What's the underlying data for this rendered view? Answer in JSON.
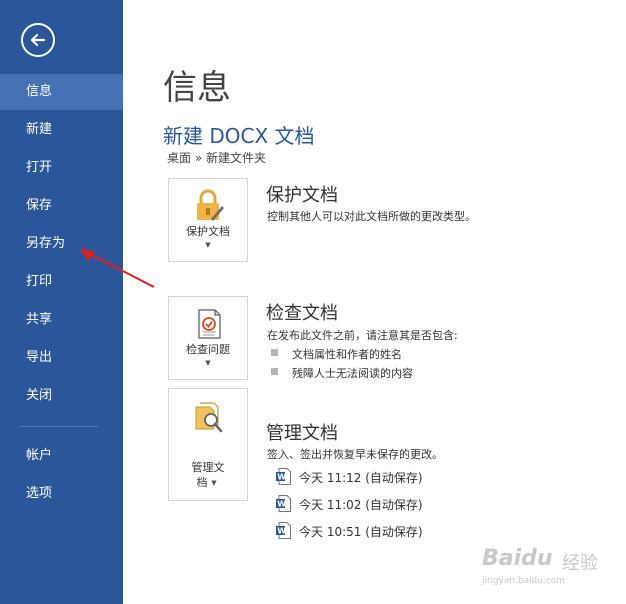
{
  "sidebar": {
    "back_label": "返回",
    "items": [
      {
        "label": "信息"
      },
      {
        "label": "新建"
      },
      {
        "label": "打开"
      },
      {
        "label": "保存"
      },
      {
        "label": "另存为"
      },
      {
        "label": "打印"
      },
      {
        "label": "共享"
      },
      {
        "label": "导出"
      },
      {
        "label": "关闭"
      },
      {
        "label": "帐户"
      },
      {
        "label": "选项"
      }
    ],
    "active_index": 0
  },
  "main": {
    "page_title": "信息",
    "doc_title": "新建 DOCX 文档",
    "path": "桌面 » 新建文件夹",
    "sections": [
      {
        "button_label": "保护文档",
        "title": "保护文档",
        "description": "控制其他人可以对此文档所做的更改类型。",
        "icon": "lock-icon"
      },
      {
        "button_label": "检查问题",
        "title": "检查文档",
        "description": "在发布此文件之前，请注意其是否包含:",
        "bullets": [
          "文档属性和作者的姓名",
          "残障人士无法阅读的内容"
        ],
        "icon": "inspect-document-icon"
      },
      {
        "button_label_line1": "管理文",
        "button_label_line2": "档",
        "title": "管理文档",
        "description": "签入、签出并恢复早未保存的更改。",
        "versions": [
          "今天 11:12 (自动保存)",
          "今天 11:02 (自动保存)",
          "今天 10:51 (自动保存)"
        ],
        "icon": "manage-versions-icon"
      }
    ]
  },
  "watermark": {
    "brand": "Baidu",
    "product": "经验",
    "url": "jingyan.baidu.com"
  },
  "colors": {
    "sidebar": "#2b579a",
    "sidebar_active": "#4472b5",
    "accent_title": "#2b579a",
    "arrow": "#e02020"
  }
}
